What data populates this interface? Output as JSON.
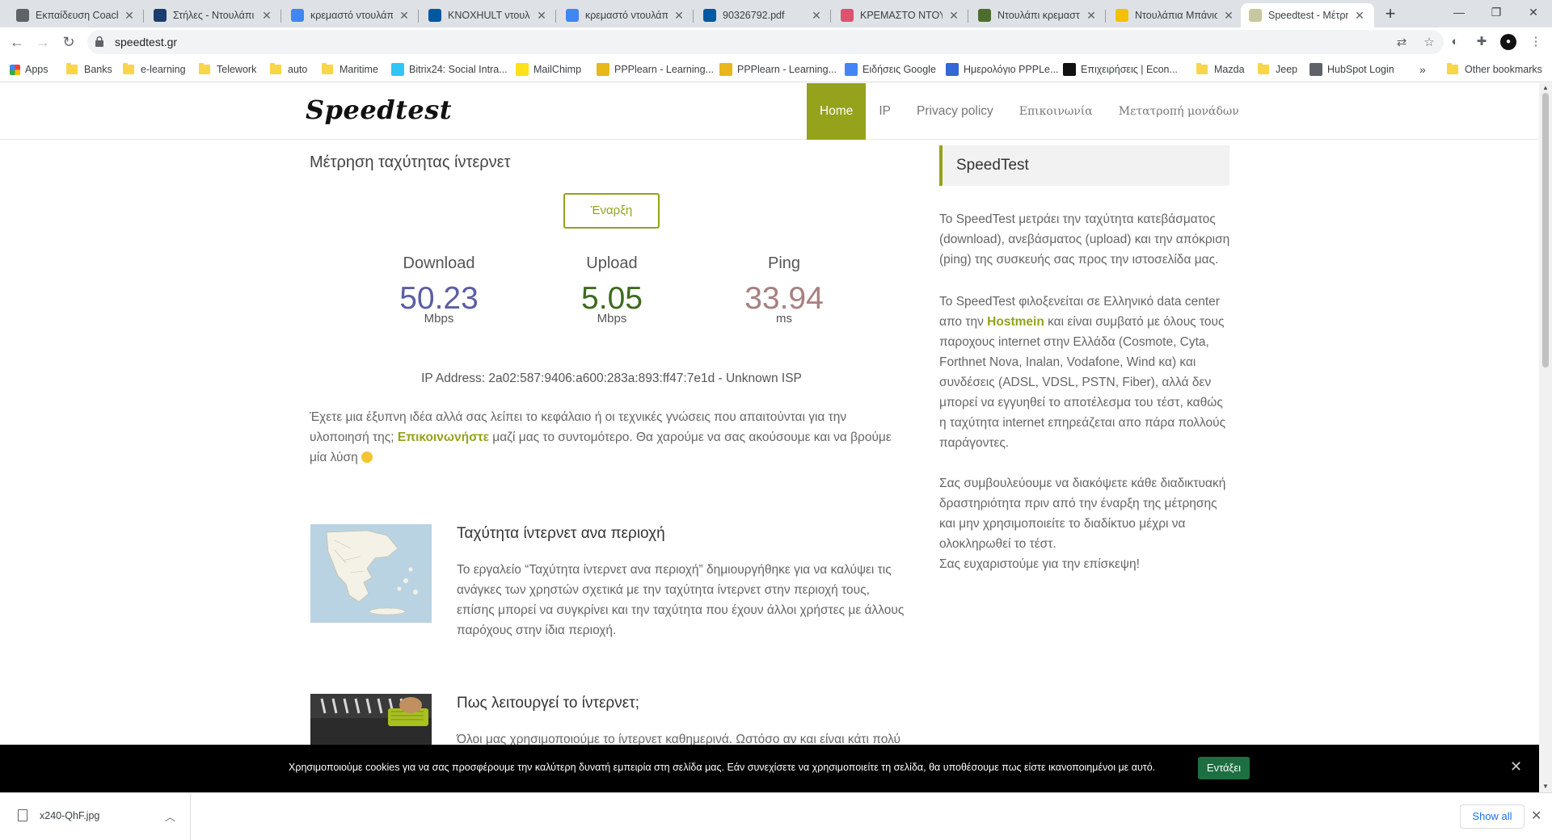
{
  "browser": {
    "tabs": [
      {
        "title": "Εκπαίδευση Coachi",
        "icon": "steam-icon",
        "color": "#5f6368"
      },
      {
        "title": "Στήλες - Ντουλάπι",
        "icon": "r-logo-icon",
        "color": "#1a3c6e"
      },
      {
        "title": "κρεμαστό ντουλάπ",
        "icon": "google-icon",
        "color": "#4285f4"
      },
      {
        "title": "KNOXHULT ντουλάπ",
        "icon": "ikea-icon",
        "color": "#0058a3"
      },
      {
        "title": "κρεμαστό ντουλάπ",
        "icon": "google-icon",
        "color": "#4285f4"
      },
      {
        "title": "90326792.pdf",
        "icon": "ikea-icon",
        "color": "#0058a3"
      },
      {
        "title": "ΚΡΕΜΑΣΤΟ ΝΤΟΥΛ",
        "icon": "shop-icon",
        "color": "#d9546e"
      },
      {
        "title": "Ντουλάπι κρεμαστ",
        "icon": "mountain-icon",
        "color": "#4b6e2c"
      },
      {
        "title": "Ντουλάπια Μπάνιο",
        "icon": "e-logo-icon",
        "color": "#f2c200"
      },
      {
        "title": "Speedtest - Μέτρησ",
        "icon": "speedtest-icon",
        "color": "#c8c8a0"
      }
    ],
    "url": "speedtest.gr",
    "bookmarks": [
      {
        "label": "Apps",
        "icon": "apps-grid-icon"
      },
      {
        "label": "Banks",
        "icon": "folder-icon"
      },
      {
        "label": "e-learning",
        "icon": "folder-icon"
      },
      {
        "label": "Telework",
        "icon": "folder-icon"
      },
      {
        "label": "auto",
        "icon": "folder-icon"
      },
      {
        "label": "Maritime",
        "icon": "folder-icon"
      },
      {
        "label": "Bitrix24: Social Intra...",
        "icon": "bitrix-icon"
      },
      {
        "label": "MailChimp",
        "icon": "mailchimp-icon"
      },
      {
        "label": "PPPlearn - Learning...",
        "icon": "ppplearn-icon"
      },
      {
        "label": "PPPlearn - Learning...",
        "icon": "ppplearn-icon"
      },
      {
        "label": "Ειδήσεις Google",
        "icon": "google-news-icon"
      },
      {
        "label": "Ημερολόγιο PPPLe...",
        "icon": "calendar-icon"
      },
      {
        "label": "Επιχειρήσεις | Econ...",
        "icon": "economist-icon"
      },
      {
        "label": "Mazda",
        "icon": "folder-icon"
      },
      {
        "label": "Jeep",
        "icon": "folder-icon"
      },
      {
        "label": "HubSpot Login",
        "icon": "globe-icon"
      }
    ],
    "bookmarks_more": "»",
    "other_bookmarks": "Other bookmarks"
  },
  "site": {
    "logo": "Speedtest",
    "nav": [
      "Home",
      "IP",
      "Privacy policy",
      "Επικοινωνία",
      "Μετατροπή μονάδων"
    ],
    "title": "Μέτρηση ταχύτητας ίντερνετ",
    "start_button": "Έναρξη",
    "metrics": [
      {
        "label": "Download",
        "value": "50.23",
        "unit": "Mbps",
        "color": "#5b5ea6"
      },
      {
        "label": "Upload",
        "value": "5.05",
        "unit": "Mbps",
        "color": "#3d6b1e"
      },
      {
        "label": "Ping",
        "value": "33.94",
        "unit": "ms",
        "color": "#a88080"
      }
    ],
    "ip_line": "IP Address: 2a02:587:9406:a600:283a:893:ff47:7e1d - Unknown ISP",
    "intro": {
      "before": "Έχετε μια έξυπνη ιδέα αλλά σας λείπει το κεφάλαιο ή οι τεχνικές γνώσεις που απαιτούνται για την υλοποιησή της; ",
      "link": "Επικοινωνήστε",
      "after": " μαζί μας το συντομότερο. Θα χαρούμε να σας ακούσουμε και να βρούμε μία λύση "
    },
    "articles": [
      {
        "title": "Ταχύτητα ίντερνετ ανα περιοχή",
        "text": "Το εργαλείο “Ταχύτητα ίντερνετ ανα περιοχή”  δημιουργήθηκε για να καλύψει τις ανάγκες των χρηστών σχετικά με την ταχύτητα ίντερνετ στην περιοχή τους, επίσης μπορεί να συγκρίνει και την ταχύτητα που έχουν άλλοι χρήστες με άλλους παρόχους στην ίδια περιοχή."
      },
      {
        "title": "Πως λειτουργεί το ίντερνετ;",
        "text": "Όλοι μας χρησιμοποιούμε το ίντερνετ καθημερινά. Ωστόσο αν και είναι κάτι πολύ"
      }
    ],
    "sidebar": {
      "heading": "SpeedTest",
      "p1": "Το SpeedTest μετράει την ταχύτητα κατεβάσματος (download), ανεβάσματος (upload) και την απόκριση (ping) της συσκευής σας προς την ιστοσελίδα μας.",
      "p2_before": "Το SpeedTest φιλοξενείται σε Ελληνικό data center απο την ",
      "p2_link": "Hostmein",
      "p2_after": " και είναι συμβατό με όλους τους παροχους internet στην Ελλάδα (Cosmote, Cyta, Forthnet Nova, Inalan, Vodafone, Wind κα) και συνδέσεις (ADSL, VDSL, PSTN, Fiber), αλλά δεν μπορεί να εγγυηθεί το αποτέλεσμα του τέστ, καθώς η ταχύτητα internet επηρεάζεται απο πάρα πολλούς παράγοντες.",
      "p3": "Σας συμβουλεύουμε να διακόψετε κάθε διαδικτυακή δραστηριότητα πριν από την έναρξη της μέτρησης και μην χρησιμοποιείτε το διαδίκτυο μέχρι να ολοκληρωθεί το τέστ.",
      "p4": "Σας ευχαριστούμε για την επίσκεψη!"
    },
    "cookie": {
      "text": "Χρησιμοποιούμε cookies για να σας προσφέρουμε την καλύτερη δυνατή εμπειρία στη σελίδα μας. Εάν συνεχίσετε να χρησιμοποιείτε τη σελίδα, θα υποθέσουμε πως είστε ικανοποιημένοι με αυτό.",
      "button": "Εντάξει"
    },
    "accent": "#95a21b"
  },
  "downloads": {
    "file": "x240-QhF.jpg",
    "show_all": "Show all"
  }
}
